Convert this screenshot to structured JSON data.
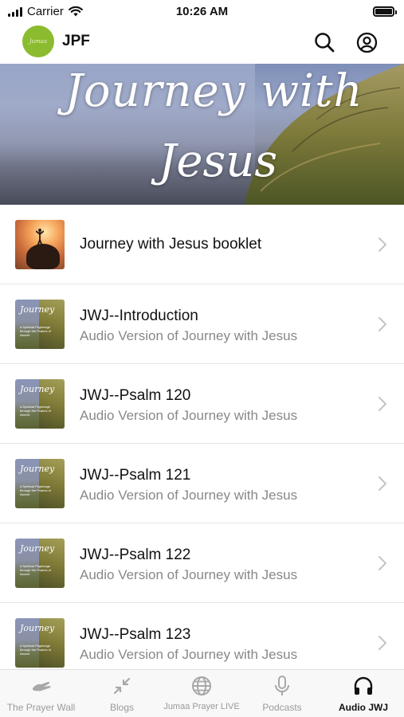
{
  "status_bar": {
    "carrier": "Carrier",
    "time": "10:26 AM"
  },
  "header": {
    "logo_text": "Jumaa",
    "title": "JPF"
  },
  "banner": {
    "line1": "Journey with",
    "line2": "Jesus"
  },
  "list": {
    "items": [
      {
        "title": "Journey with Jesus booklet",
        "subtitle": "",
        "thumbnail": "sunset-person-on-rock"
      },
      {
        "title": "JWJ--Introduction",
        "subtitle": "Audio Version of Journey with Jesus",
        "thumbnail": "journey-with-jesus-cover"
      },
      {
        "title": "JWJ--Psalm 120",
        "subtitle": "Audio Version of Journey with Jesus",
        "thumbnail": "journey-with-jesus-cover"
      },
      {
        "title": "JWJ--Psalm 121",
        "subtitle": "Audio Version of Journey with Jesus",
        "thumbnail": "journey-with-jesus-cover"
      },
      {
        "title": "JWJ--Psalm 122",
        "subtitle": "Audio Version of Journey with Jesus",
        "thumbnail": "journey-with-jesus-cover"
      },
      {
        "title": "JWJ--Psalm 123",
        "subtitle": "Audio Version of Journey with Jesus",
        "thumbnail": "journey-with-jesus-cover"
      }
    ]
  },
  "thumb_cover": {
    "title": "Journey",
    "caption": "A Spiritual Pilgrimage through the Psalms of Ascent"
  },
  "tabs": [
    {
      "label": "The Prayer Wall",
      "icon": "praying-hands-icon",
      "active": false
    },
    {
      "label": "Blogs",
      "icon": "compress-arrows-icon",
      "active": false
    },
    {
      "label": "Jumaa Prayer LIVE",
      "icon": "globe-icon",
      "active": false
    },
    {
      "label": "Podcasts",
      "icon": "microphone-icon",
      "active": false
    },
    {
      "label": "Audio JWJ",
      "icon": "headphones-icon",
      "active": true
    }
  ],
  "colors": {
    "logo_green": "#8bbb2e",
    "active_tab": "#111111",
    "inactive_tab": "#9a9a9a"
  }
}
